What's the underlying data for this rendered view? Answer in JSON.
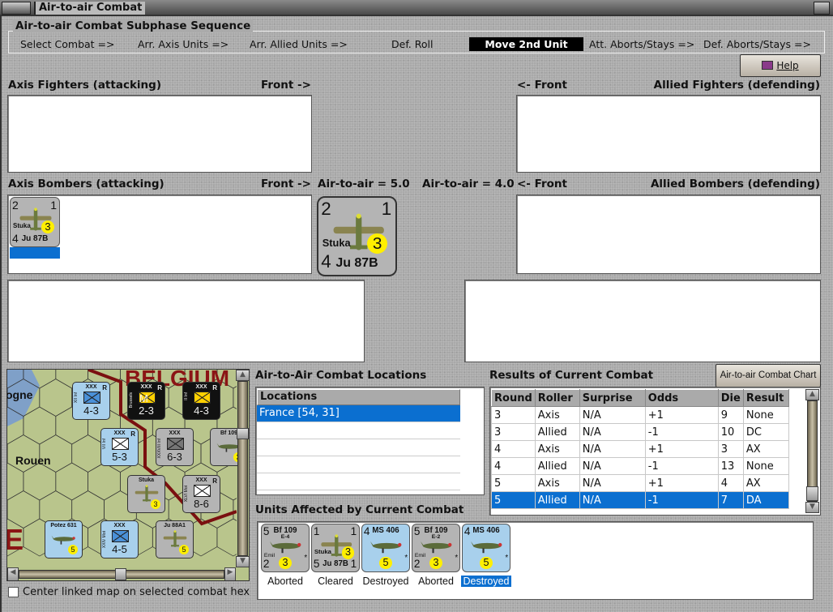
{
  "window": {
    "title": "Air-to-air Combat"
  },
  "sequence": {
    "title": "Air-to-air Combat Subphase Sequence",
    "steps": [
      "Select Combat =>",
      "Arr. Axis Units =>",
      "Arr. Allied Units =>",
      "Def. Roll",
      "Move 2nd Unit",
      "Att. Aborts/Stays =>",
      "Def. Aborts/Stays =>"
    ],
    "active": "Move 2nd Unit"
  },
  "help_button": {
    "label": "Help",
    "icon": "book-icon"
  },
  "axis_fighters": {
    "label": "Axis Fighters (attacking)",
    "front": "Front ->"
  },
  "allied_fighters": {
    "label": "Allied Fighters (defending)",
    "front": "<- Front"
  },
  "axis_bombers": {
    "label": "Axis Bombers (attacking)",
    "front": "Front ->",
    "air_to_air": "Air-to-air = 5.0"
  },
  "allied_bombers": {
    "label": "Allied Bombers (defending)",
    "front": "<- Front",
    "air_to_air": "Air-to-air = 4.0"
  },
  "selected_unit": {
    "tl": "2",
    "tr": "1",
    "name": "Stuka",
    "bl": "4",
    "model": "Ju 87B",
    "star": "*",
    "circle": "3"
  },
  "locations": {
    "label": "Air-to-Air Combat Locations",
    "header": "Locations",
    "rows": [
      "France [54, 31]"
    ],
    "selected": 0
  },
  "results": {
    "label": "Results of Current Combat",
    "chart_button": "Air-to-air Combat Chart",
    "columns": [
      "Round",
      "Roller",
      "Surprise",
      "Odds",
      "Die",
      "Result"
    ],
    "rows": [
      [
        "3",
        "Axis",
        "N/A",
        "+1",
        "9",
        "None"
      ],
      [
        "3",
        "Allied",
        "N/A",
        "-1",
        "10",
        "DC"
      ],
      [
        "4",
        "Axis",
        "N/A",
        "+1",
        "3",
        "AX"
      ],
      [
        "4",
        "Allied",
        "N/A",
        "-1",
        "13",
        "None"
      ],
      [
        "5",
        "Axis",
        "N/A",
        "+1",
        "4",
        "AX"
      ],
      [
        "5",
        "Allied",
        "N/A",
        "-1",
        "7",
        "DA"
      ]
    ],
    "selected": 5
  },
  "units_affected": {
    "label": "Units Affected by Current Combat",
    "units": [
      {
        "tl": "5",
        "name": "Bf 109",
        "sub": "E-4",
        "nick": "Emil",
        "bl": "2",
        "circle": "3",
        "status": "Aborted",
        "side": "axis"
      },
      {
        "tl": "1",
        "tr": "1",
        "name": "Stuka",
        "bl": "5",
        "model": "Ju 87B",
        "br": "1",
        "circle": "3",
        "status": "Cleared",
        "side": "axis"
      },
      {
        "tl": "4",
        "name": "MS 406",
        "circle": "5",
        "status": "Destroyed",
        "side": "allied"
      },
      {
        "tl": "5",
        "name": "Bf 109",
        "sub": "E-2",
        "nick": "Emil",
        "bl": "2",
        "circle": "3",
        "status": "Aborted",
        "side": "axis"
      },
      {
        "tl": "4",
        "name": "MS 406",
        "circle": "5",
        "status": "Destroyed",
        "side": "allied",
        "selected": true
      }
    ]
  },
  "map": {
    "labels": [
      "ogne",
      "Rouen",
      "BELGIUM"
    ],
    "units": [
      {
        "top": "XXX",
        "tr": "R",
        "side": "XII Inf",
        "val": "4-3",
        "kind": "fr"
      },
      {
        "top": "XXX",
        "tr": "R",
        "side": "Brussels",
        "val": "2-3",
        "kind": "bel",
        "mark": "M"
      },
      {
        "top": "XXX",
        "tr": "R",
        "side": "II Inf",
        "val": "4-3",
        "kind": "bel"
      },
      {
        "top": "XXX",
        "tr": "R",
        "side": "VII Inf",
        "val": "5-3",
        "kind": "frw"
      },
      {
        "top": "XXX",
        "side": "XXXVIII Inf",
        "val": "6-3",
        "kind": "gr"
      },
      {
        "top": "Bf 109",
        "tr": "",
        "val": "3",
        "kind": "air"
      },
      {
        "top": "Stuka",
        "val": "3",
        "kind": "air"
      },
      {
        "top": "XXX",
        "tr": "R",
        "side": "XLVI Mot",
        "val": "8-6",
        "kind": "grw"
      },
      {
        "top": "Potez 631",
        "val": "5",
        "kind": "airb"
      },
      {
        "top": "XXX",
        "side": "XXIV Mot",
        "val": "4-5",
        "kind": "fr"
      },
      {
        "top": "Ju 88A1",
        "val": "5",
        "kind": "air"
      }
    ]
  },
  "checkbox": {
    "label": "Center linked map on selected combat hex",
    "checked": false
  },
  "colors": {
    "axis_counter": "#b4b4b4",
    "allied_counter": "#a8d0ec",
    "selection": "#0b6fd0",
    "belgian": "#111111"
  }
}
